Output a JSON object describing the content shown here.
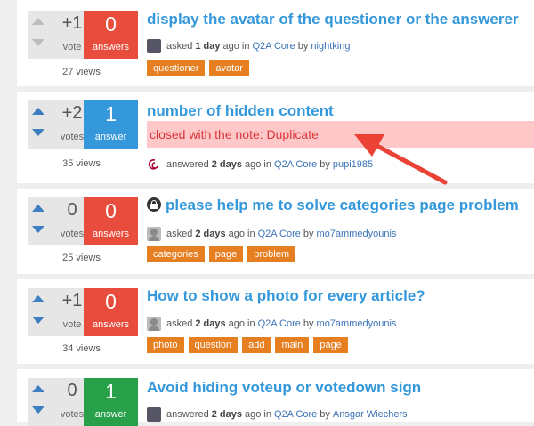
{
  "colors": {
    "accent": "#3498db",
    "tag": "#e67e22",
    "zero_answers": "#e74c3c",
    "one_answer": "#3498db",
    "accepted": "#27a049",
    "closed_bg": "#ffc8c8",
    "closed_text": "#d9363a",
    "annotation_arrow": "#ea4335"
  },
  "questions": [
    {
      "votes": "+1",
      "votes_label": "vote",
      "answers": "0",
      "answers_label": "answers",
      "views": "27 views",
      "title": "display the avatar of the questioner or the answerer",
      "action": "asked",
      "when": "1 day",
      "ago": "ago",
      "in": "in",
      "category": "Q2A Core",
      "by": "by",
      "user": "nightking",
      "tags": [
        "questioner",
        "avatar"
      ]
    },
    {
      "votes": "+2",
      "votes_label": "votes",
      "answers": "1",
      "answers_label": "answer",
      "views": "35 views",
      "title": "number of hidden content",
      "closed_note": "closed with the note: Duplicate",
      "action": "answered",
      "when": "2 days",
      "ago": "ago",
      "in": "in",
      "category": "Q2A Core",
      "by": "by",
      "user": "pupi1985",
      "tags": []
    },
    {
      "votes": "0",
      "votes_label": "votes",
      "answers": "0",
      "answers_label": "answers",
      "views": "25 views",
      "title": "please help me to solve categories page problem",
      "action": "asked",
      "when": "2 days",
      "ago": "ago",
      "in": "in",
      "category": "Q2A Core",
      "by": "by",
      "user": "mo7ammedyounis",
      "tags": [
        "categories",
        "page",
        "problem"
      ]
    },
    {
      "votes": "+1",
      "votes_label": "vote",
      "answers": "0",
      "answers_label": "answers",
      "views": "34 views",
      "title": "How to show a photo for every article?",
      "action": "asked",
      "when": "2 days",
      "ago": "ago",
      "in": "in",
      "category": "Q2A Core",
      "by": "by",
      "user": "mo7ammedyounis",
      "tags": [
        "photo",
        "question",
        "add",
        "main",
        "page"
      ]
    },
    {
      "votes": "0",
      "votes_label": "votes",
      "answers": "1",
      "answers_label": "answer",
      "views": "",
      "title": "Avoid hiding voteup or votedown sign",
      "action": "answered",
      "when": "2 days",
      "ago": "ago",
      "in": "in",
      "category": "Q2A Core",
      "by": "by",
      "user": "Ansgar Wiechers",
      "tags": []
    }
  ]
}
